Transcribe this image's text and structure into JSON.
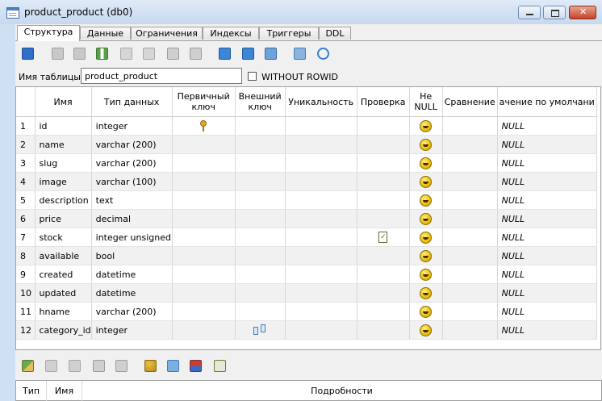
{
  "window": {
    "title": "product_product (db0)"
  },
  "tabs": [
    "Структура",
    "Данные",
    "Ограничения",
    "Индексы",
    "Триггеры",
    "DDL"
  ],
  "table_name": {
    "label": "Имя таблицы:",
    "value": "product_product",
    "without_rowid": "WITHOUT ROWID"
  },
  "columns": {
    "headers": {
      "name": "Имя",
      "type": "Тип данных",
      "pk": "Первичный ключ",
      "fk": "Внешний ключ",
      "unique": "Уникальность",
      "check": "Проверка",
      "notnull": "Не NULL",
      "collate": "Сравнение",
      "default": "ачение по умолчани"
    },
    "rows": [
      {
        "num": "1",
        "name": "id",
        "type": "integer",
        "default": "NULL"
      },
      {
        "num": "2",
        "name": "name",
        "type": "varchar (200)",
        "default": "NULL"
      },
      {
        "num": "3",
        "name": "slug",
        "type": "varchar (200)",
        "default": "NULL"
      },
      {
        "num": "4",
        "name": "image",
        "type": "varchar (100)",
        "default": "NULL"
      },
      {
        "num": "5",
        "name": "description",
        "type": "text",
        "default": "NULL"
      },
      {
        "num": "6",
        "name": "price",
        "type": "decimal",
        "default": "NULL"
      },
      {
        "num": "7",
        "name": "stock",
        "type": "integer unsigned",
        "default": "NULL"
      },
      {
        "num": "8",
        "name": "available",
        "type": "bool",
        "default": "NULL"
      },
      {
        "num": "9",
        "name": "created",
        "type": "datetime",
        "default": "NULL"
      },
      {
        "num": "10",
        "name": "updated",
        "type": "datetime",
        "default": "NULL"
      },
      {
        "num": "11",
        "name": "hname",
        "type": "varchar (200)",
        "default": "NULL"
      },
      {
        "num": "12",
        "name": "category_id",
        "type": "integer",
        "default": "NULL"
      }
    ]
  },
  "constraints": {
    "headers": {
      "type": "Тип",
      "name": "Имя",
      "details": "Подробности"
    }
  },
  "icons": {
    "primary_key": "key-icon",
    "not_null": "smiley-icon",
    "check": "checklist-icon",
    "foreign_key": "foreign-key-icon"
  },
  "colors": {
    "window_frame": "#cfe0f2",
    "panel": "#f0f0f0",
    "alt_row": "#f1f1f1"
  }
}
